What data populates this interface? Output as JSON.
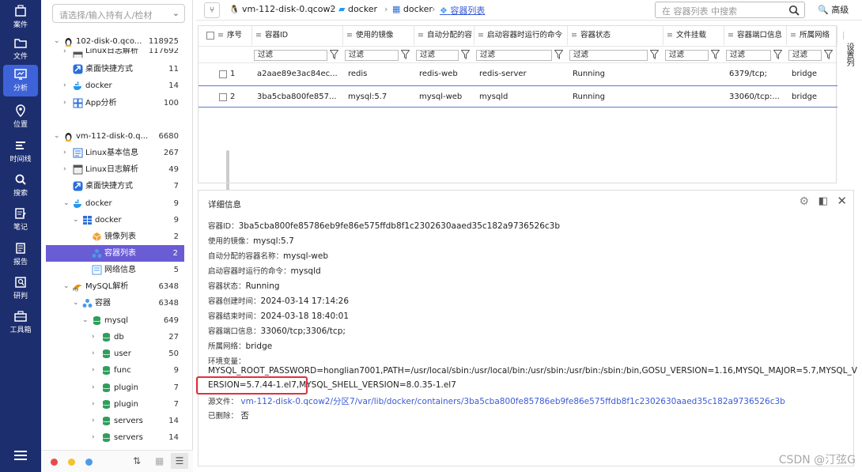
{
  "nav": {
    "items": [
      {
        "label": "案件"
      },
      {
        "label": "文件"
      },
      {
        "label": "分析"
      },
      {
        "label": "位置"
      },
      {
        "label": "时间线"
      },
      {
        "label": "搜索"
      },
      {
        "label": "笔记"
      },
      {
        "label": "报告"
      },
      {
        "label": "研判"
      },
      {
        "label": "工具箱"
      }
    ]
  },
  "tree": {
    "search_placeholder": "请选择/输入持有人/检材",
    "rows": [
      {
        "label": "102-disk-0.qco...",
        "count": "118925"
      },
      {
        "label": "Linux日志解析",
        "count": "117692"
      },
      {
        "label": "桌面快捷方式",
        "count": "11"
      },
      {
        "label": "docker",
        "count": "14"
      },
      {
        "label": "App分析",
        "count": "100"
      },
      {
        "label": "vm-112-disk-0.q...",
        "count": "6680"
      },
      {
        "label": "Linux基本信息",
        "count": "267"
      },
      {
        "label": "Linux日志解析",
        "count": "49"
      },
      {
        "label": "桌面快捷方式",
        "count": "7"
      },
      {
        "label": "docker",
        "count": "9"
      },
      {
        "label": "docker",
        "count": "9"
      },
      {
        "label": "镜像列表",
        "count": "2"
      },
      {
        "label": "容器列表",
        "count": "2"
      },
      {
        "label": "网络信息",
        "count": "5"
      },
      {
        "label": "MySQL解析",
        "count": "6348"
      },
      {
        "label": "容器",
        "count": "6348"
      },
      {
        "label": "mysql",
        "count": "649"
      },
      {
        "label": "db",
        "count": "27"
      },
      {
        "label": "user",
        "count": "50"
      },
      {
        "label": "func",
        "count": "9"
      },
      {
        "label": "plugin",
        "count": "7"
      },
      {
        "label": "plugin",
        "count": "7"
      },
      {
        "label": "servers",
        "count": "14"
      },
      {
        "label": "servers",
        "count": "14"
      }
    ]
  },
  "breadcrumb": {
    "items": [
      "vm-112-disk-0.qcow2",
      "docker",
      "docker",
      "容器列表"
    ],
    "search_placeholder": "在 容器列表 中搜索",
    "advanced": "高级"
  },
  "table": {
    "headers": [
      "序号",
      "容器ID",
      "使用的镜像",
      "自动分配的容",
      "启动容器时运行的命令",
      "容器状态",
      "文件挂载",
      "容器端口信息",
      "所属网络"
    ],
    "filter_placeholder": "过滤",
    "rows": [
      {
        "idx": "1",
        "id": "a2aae89e3ac84ec...",
        "image": "redis",
        "name": "redis-web",
        "cmd": "redis-server",
        "status": "Running",
        "mount": "",
        "port": "6379/tcp;",
        "network": "bridge"
      },
      {
        "idx": "2",
        "id": "3ba5cba800fe857...",
        "image": "mysql:5.7",
        "name": "mysql-web",
        "cmd": "mysqld",
        "status": "Running",
        "mount": "",
        "port": "33060/tcp:...",
        "network": "bridge"
      }
    ],
    "side_settings": "设置列"
  },
  "detail": {
    "title": "详细信息",
    "fields": [
      {
        "key": "容器ID：",
        "value": "3ba5cba800fe85786eb9fe86e575ffdb8f1c2302630aaed35c182a9736526c3b"
      },
      {
        "key": "使用的镜像：",
        "value": "mysql:5.7"
      },
      {
        "key": "自动分配的容器名称：",
        "value": "mysql-web"
      },
      {
        "key": "启动容器时运行的命令：",
        "value": "mysqld"
      },
      {
        "key": "容器状态：",
        "value": "Running"
      },
      {
        "key": "容器创建时间：",
        "value": "2024-03-14 17:14:26"
      },
      {
        "key": "容器结束时间：",
        "value": "2024-03-18 18:40:01"
      },
      {
        "key": "容器端口信息：",
        "value": "33060/tcp;3306/tcp;"
      },
      {
        "key": "所属网络：",
        "value": "bridge"
      },
      {
        "key": "环境变量：",
        "value": ""
      }
    ],
    "env_line1": "MYSQL_ROOT_PASSWORD=honglian7001,PATH=/usr/local/sbin:/usr/local/bin:/usr/sbin:/usr/bin:/sbin:/bin,GOSU_VERSION=1.16,MYSQL_MAJOR=5.7,MYSQL_V",
    "env_line2": "ERSION=5.7.44-1.el7,MYSQL_SHELL_VERSION=8.0.35-1.el7",
    "source_key": "源文件：",
    "source_value": "vm-112-disk-0.qcow2/分区7/var/lib/docker/containers/3ba5cba800fe85786eb9fe86e575ffdb8f1c2302630aaed35c182a9736526c3b",
    "deleted_key": "已删除：",
    "deleted_value": "否"
  },
  "watermark": "CSDN @汀弦G"
}
